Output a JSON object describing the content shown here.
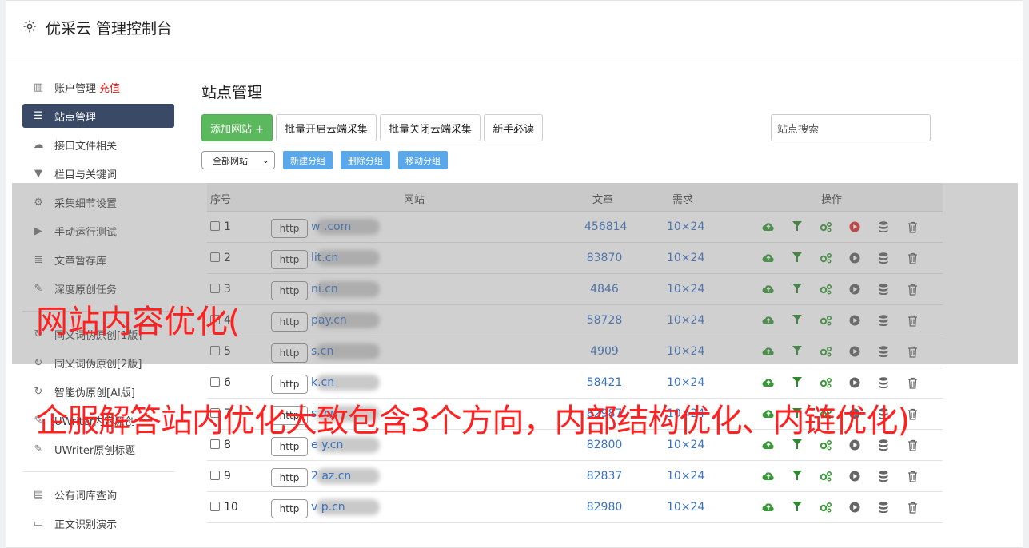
{
  "app": {
    "title": "优采云 管理控制台"
  },
  "sidebar": {
    "items": [
      {
        "label": "账户管理",
        "extra": "充值",
        "icon": "bar-chart-icon"
      },
      {
        "label": "站点管理",
        "icon": "list-icon"
      },
      {
        "label": "接口文件相关",
        "icon": "cloud-upload-icon"
      },
      {
        "label": "栏目与关键词",
        "icon": "filter-icon"
      },
      {
        "label": "采集细节设置",
        "icon": "gears-icon"
      },
      {
        "label": "手动运行测试",
        "icon": "play-icon"
      },
      {
        "label": "文章暂存库",
        "icon": "database-icon"
      },
      {
        "label": "深度原创任务",
        "icon": "edit-icon"
      },
      {
        "label": "同义词伪原创[1版]",
        "icon": "refresh-icon"
      },
      {
        "label": "同义词伪原创[2版]",
        "icon": "refresh-icon"
      },
      {
        "label": "智能伪原创[AI版]",
        "icon": "refresh-icon"
      },
      {
        "label": "UWriter内容原创",
        "icon": "edit-icon"
      },
      {
        "label": "UWriter原创标题",
        "icon": "edit-icon"
      },
      {
        "label": "公有词库查询",
        "icon": "book-icon"
      },
      {
        "label": "正文识别演示",
        "icon": "monitor-icon"
      }
    ]
  },
  "main": {
    "title": "站点管理",
    "buttons": {
      "add": "添加网站 +",
      "batch_on": "批量开启云端采集",
      "batch_off": "批量关闭云端采集",
      "guide": "新手必读"
    },
    "search_placeholder": "站点搜索",
    "group_select": "全部网站",
    "group_buttons": {
      "new": "新建分组",
      "delete": "删除分组",
      "move": "移动分组"
    },
    "table": {
      "headers": {
        "index": "序号",
        "site": "网站",
        "articles": "文章",
        "demand": "需求",
        "ops": "操作"
      },
      "rows": [
        {
          "idx": "1",
          "http": "http",
          "site": "w .com",
          "articles": "456814",
          "demand": "10×24"
        },
        {
          "idx": "2",
          "http": "http",
          "site": "lit.cn",
          "articles": "83870",
          "demand": "10×24"
        },
        {
          "idx": "3",
          "http": "http",
          "site": "ni.cn",
          "articles": "4846",
          "demand": "10×24"
        },
        {
          "idx": "4",
          "http": "http",
          "site": "pay.cn",
          "articles": "58728",
          "demand": "10×24"
        },
        {
          "idx": "5",
          "http": "http",
          "site": "s.cn",
          "articles": "4909",
          "demand": "10×24"
        },
        {
          "idx": "6",
          "http": "http",
          "site": "k.cn",
          "articles": "58421",
          "demand": "10×24"
        },
        {
          "idx": "7",
          "http": "http",
          "site": "s .cn",
          "articles": "82987",
          "demand": "10×24"
        },
        {
          "idx": "8",
          "http": "http",
          "site": "e y.cn",
          "articles": "82800",
          "demand": "10×24"
        },
        {
          "idx": "9",
          "http": "http",
          "site": "2 az.cn",
          "articles": "82837",
          "demand": "10×24"
        },
        {
          "idx": "10",
          "http": "http",
          "site": "v p.cn",
          "articles": "82980",
          "demand": "10×24"
        }
      ]
    }
  },
  "overlay": {
    "line1": "网站内容优化(",
    "line2": "企服解答站内优化大致包含3个方向，内部结构优化、内链优化)"
  },
  "colors": {
    "accent": "#5cb85c",
    "sidebar_active": "#3a4a66",
    "link": "#3a73c4",
    "overlay_text": "#ff2020"
  }
}
